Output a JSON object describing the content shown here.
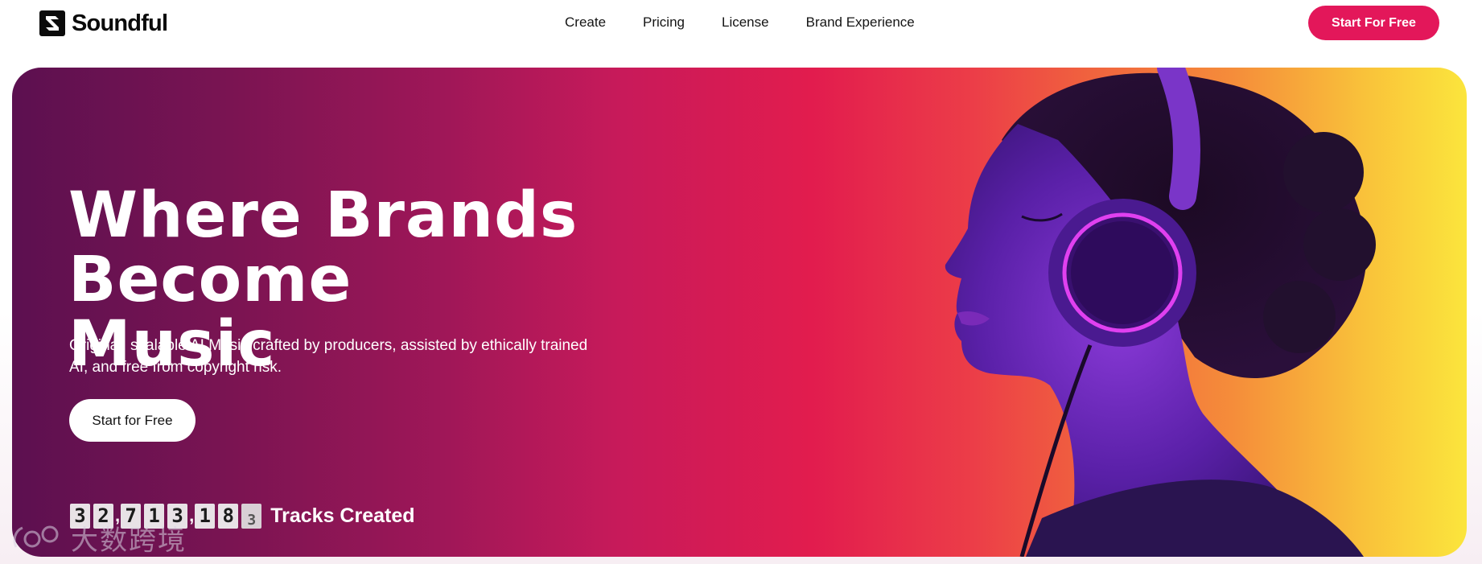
{
  "nav": {
    "brand": "Soundful",
    "links": [
      "Create",
      "Pricing",
      "License",
      "Brand Experience"
    ],
    "cta": "Start For Free"
  },
  "hero": {
    "title_line1": "Where Brands Become",
    "title_line2": "Music",
    "subtitle_line1": "Original, scalable AI Music crafted by producers, assisted by ethically trained",
    "subtitle_line2": "AI, and free from copyright risk.",
    "button": "Start for Free",
    "counter": {
      "digits": [
        "3",
        "2",
        "7",
        "1",
        "3",
        "1",
        "8",
        "3"
      ],
      "separator": ",",
      "label": "Tracks Created"
    },
    "image": "woman-with-headphones-portrait"
  },
  "watermark": {
    "text": "大数跨境",
    "icon": "watermark-logo-icon"
  },
  "colors": {
    "accent": "#e3175a",
    "hero_start": "#5c1050",
    "hero_mid": "#e21c4e",
    "hero_end": "#fbe53c",
    "headphone_glow": "#e040f0"
  }
}
